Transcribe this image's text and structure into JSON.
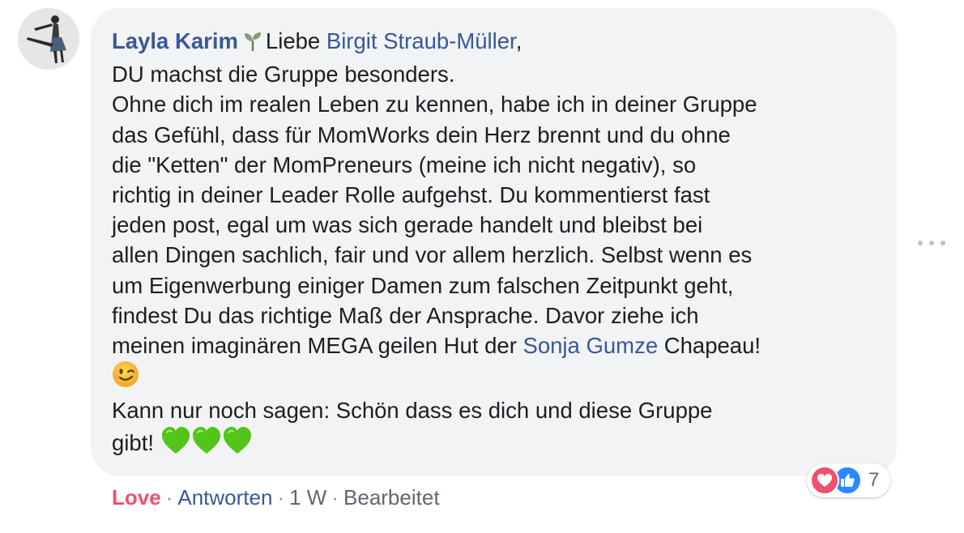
{
  "comment": {
    "author": "Layla Karim",
    "badge_icon": "sprout-icon",
    "greeting": "Liebe",
    "mention_1": "Birgit Straub-Müller",
    "comma": ",",
    "lines": [
      "DU machst die Gruppe besonders.",
      "Ohne dich im realen Leben zu kennen, habe ich in deiner Gruppe",
      "das Gefühl, dass für MomWorks dein Herz brennt und du ohne",
      "die \"Ketten\" der MomPreneurs (meine ich nicht negativ), so",
      "richtig in deiner Leader Rolle aufgehst. Du kommentierst fast",
      "jeden post, egal um was sich gerade handelt und bleibst bei",
      "allen Dingen sachlich, fair und vor allem herzlich. Selbst wenn es",
      "um Eigenwerbung einiger Damen zum falschen Zeitpunkt geht,",
      "findest Du das richtige Maß der Ansprache. Davor ziehe ich"
    ],
    "hat_line_before": "meinen imaginären MEGA geilen Hut der ",
    "mention_2": "Sonja Gumze",
    "hat_line_after": " Chapeau!",
    "wink_emoji": "winking-face-emoji",
    "closing_line": "Kann nur noch sagen: Schön dass es dich und diese Gruppe",
    "closing_end": "gibt!",
    "hearts_emoji": "green-heart-emoji"
  },
  "reactions": {
    "types": [
      "love",
      "like"
    ],
    "count": "7",
    "love_color": "#f0506e",
    "like_color": "#2d88ff"
  },
  "actions": {
    "reaction_label": "Love",
    "reply_label": "Antworten",
    "time": "1 W",
    "edited": "Bearbeitet",
    "separator": "·"
  },
  "colors": {
    "bubble": "#f2f3f5",
    "link": "#385898",
    "meta": "#606770"
  }
}
